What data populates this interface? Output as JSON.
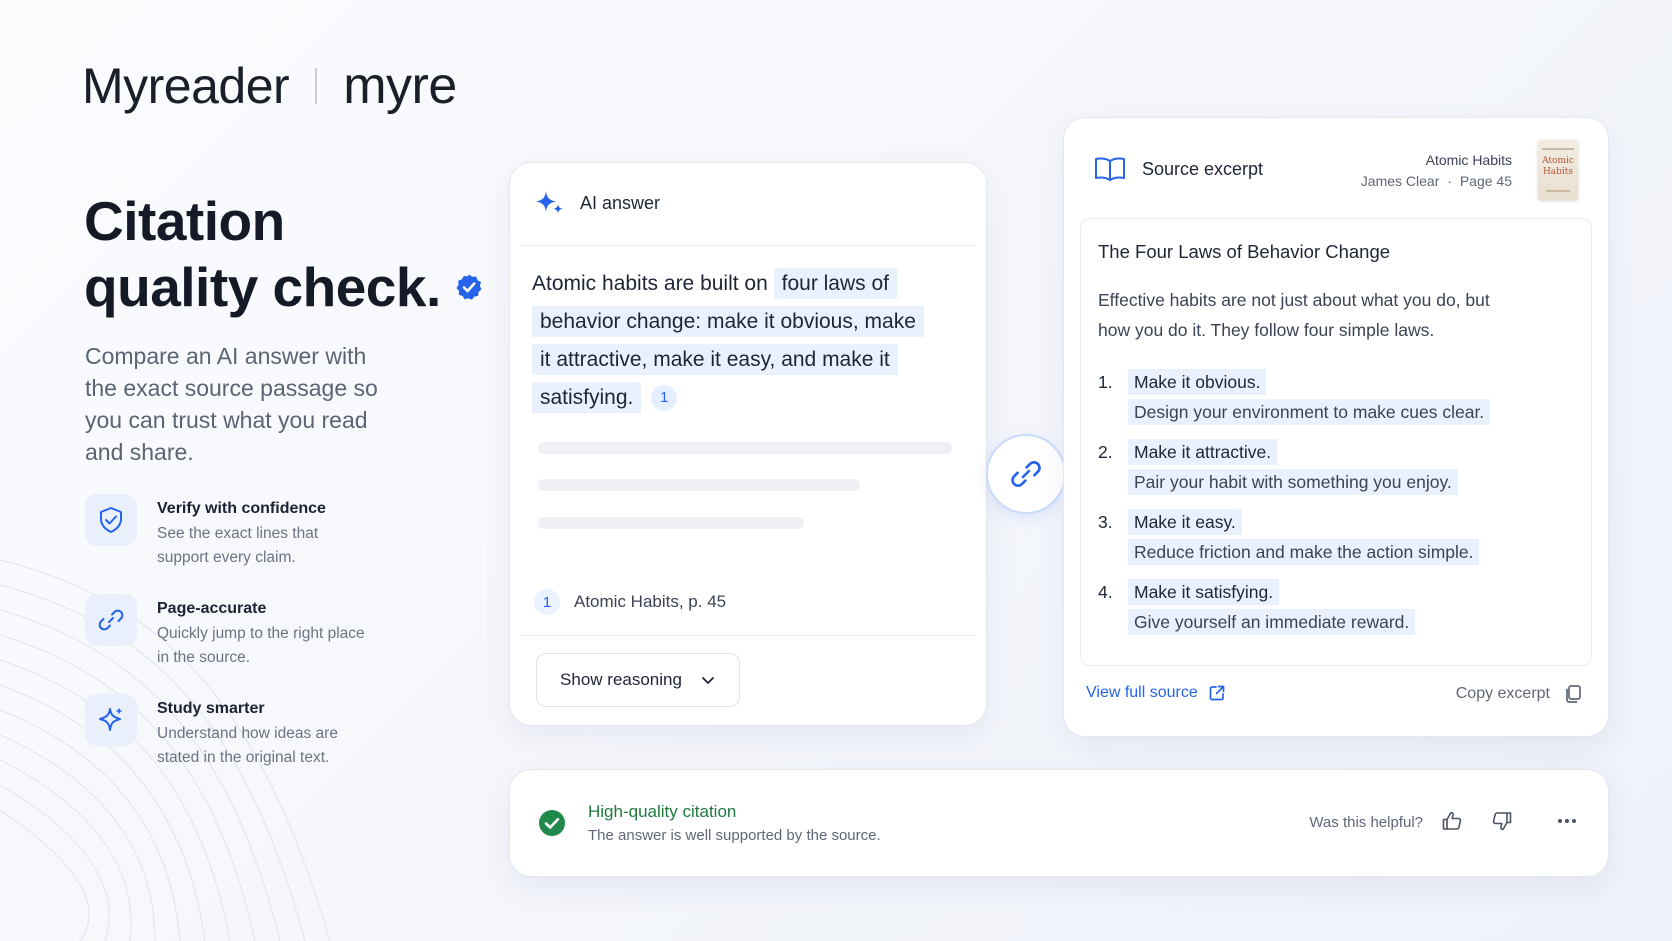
{
  "brand": {
    "name": "Myreader",
    "alt_name": "myre"
  },
  "hero": {
    "title_line1": "Citation",
    "title_line2": "quality check.",
    "subtitle": "Compare an AI answer with the exact source passage so you can trust what you read and share."
  },
  "features": [
    {
      "icon": "shield-check-icon",
      "title": "Verify with confidence",
      "desc": "See the exact lines that support every claim."
    },
    {
      "icon": "link-icon",
      "title": "Page-accurate",
      "desc": "Quickly jump to the right place in the source."
    },
    {
      "icon": "sparkle-icon",
      "title": "Study smarter",
      "desc": "Understand how ideas are stated in the original text."
    }
  ],
  "ai_answer": {
    "header": "AI answer",
    "text_plain": "Atomic habits are built on ",
    "text_highlight": "four laws of behavior change: make it obvious, make it attractive, make it easy, and make it satisfying.",
    "citation_number": "1",
    "source_number": "1",
    "source_label": "Atomic Habits, p. 45",
    "reasoning_button": "Show reasoning"
  },
  "source_excerpt": {
    "header": "Source excerpt",
    "book_title": "Atomic Habits",
    "author": "James Clear",
    "meta_sep": "·",
    "page": "Page 45",
    "cover_text": "Atomic Habits",
    "section_title": "The Four Laws of Behavior Change",
    "intro": "Effective habits are not just about what you do, but how you do it. They follow four simple laws.",
    "laws": [
      {
        "num": "1.",
        "title": "Make it obvious.",
        "desc": "Design your environment to make cues clear."
      },
      {
        "num": "2.",
        "title": "Make it attractive.",
        "desc": "Pair your habit with something you enjoy."
      },
      {
        "num": "3.",
        "title": "Make it easy.",
        "desc": "Reduce friction and make the action simple."
      },
      {
        "num": "4.",
        "title": "Make it satisfying.",
        "desc": "Give yourself an immediate reward."
      }
    ],
    "view_full_label": "View full source",
    "copy_label": "Copy excerpt"
  },
  "status": {
    "title": "High-quality citation",
    "desc": "The answer is well supported by the source.",
    "helpful_prompt": "Was this helpful?"
  },
  "colors": {
    "accent": "#2563eb",
    "highlight": "#e9f1fe",
    "success": "#1f7a3c"
  }
}
